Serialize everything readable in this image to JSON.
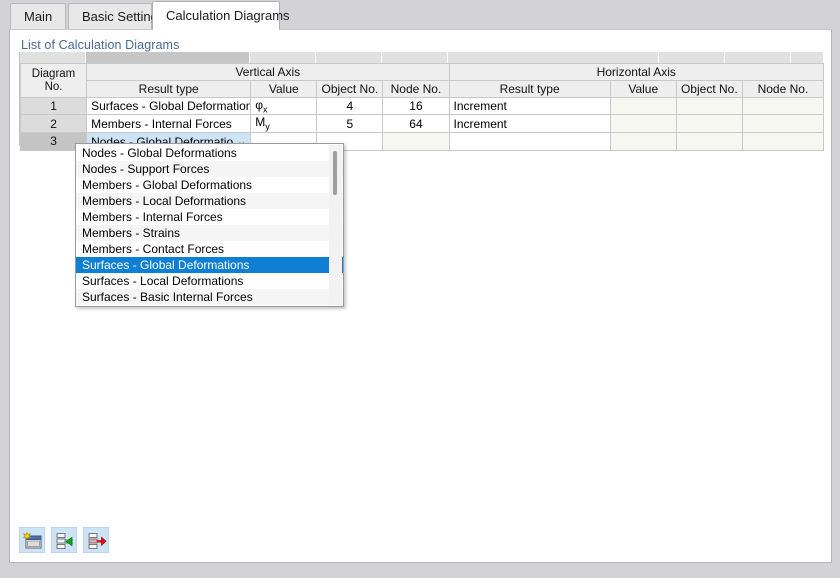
{
  "window": {
    "background_color": "#d2d2d7",
    "panel_background": "#ffffff"
  },
  "tabs": [
    {
      "label": "Main",
      "active": false
    },
    {
      "label": "Basic Settings",
      "active": false
    },
    {
      "label": "Calculation Diagrams",
      "active": true
    }
  ],
  "group": {
    "title": "List of Calculation Diagrams",
    "title_color": "#4a6a96"
  },
  "table": {
    "axis_groups": [
      {
        "label": "Vertical Axis"
      },
      {
        "label": "Horizontal Axis"
      }
    ],
    "row_header": {
      "line1": "Diagram",
      "line2": "No."
    },
    "columns": [
      "Result type",
      "Value",
      "Object No.",
      "Node No.",
      "Result type",
      "Value",
      "Object No.",
      "Node No."
    ],
    "rows": [
      {
        "no": "1",
        "selected": false,
        "editing": false,
        "v_result_type": "Surfaces - Global Deformations",
        "v_value_base": "φ",
        "v_value_sub": "x",
        "v_object_no": "4",
        "v_node_no": "16",
        "h_result_type": "Increment",
        "h_value": "",
        "h_object_no": "",
        "h_node_no": ""
      },
      {
        "no": "2",
        "selected": false,
        "editing": false,
        "v_result_type": "Members - Internal Forces",
        "v_value_base": "M",
        "v_value_sub": "y",
        "v_object_no": "5",
        "v_node_no": "64",
        "h_result_type": "Increment",
        "h_value": "",
        "h_object_no": "",
        "h_node_no": ""
      },
      {
        "no": "3",
        "selected": true,
        "editing": true,
        "v_result_type": "Nodes - Global Deformatio...",
        "v_value_base": "",
        "v_value_sub": "",
        "v_object_no": "",
        "v_node_no": "",
        "h_result_type": "",
        "h_value": "",
        "h_object_no": "",
        "h_node_no": ""
      }
    ]
  },
  "combobox": {
    "value": "Nodes - Global Deformatio...",
    "chevron": "⌄",
    "background": "#cfe3f7"
  },
  "dropdown": {
    "highlight_color": "#0f7fd4",
    "items": [
      {
        "label": "Nodes - Global Deformations",
        "highlighted": false
      },
      {
        "label": "Nodes - Support Forces",
        "highlighted": false
      },
      {
        "label": "Members - Global Deformations",
        "highlighted": false
      },
      {
        "label": "Members - Local Deformations",
        "highlighted": false
      },
      {
        "label": "Members - Internal Forces",
        "highlighted": false
      },
      {
        "label": "Members - Strains",
        "highlighted": false
      },
      {
        "label": "Members - Contact Forces",
        "highlighted": false
      },
      {
        "label": "Surfaces - Global Deformations",
        "highlighted": true
      },
      {
        "label": "Surfaces - Local Deformations",
        "highlighted": false
      },
      {
        "label": "Surfaces - Basic Internal Forces",
        "highlighted": false
      }
    ]
  },
  "toolbar": {
    "buttons": [
      {
        "name": "new-row-icon",
        "title": "New"
      },
      {
        "name": "insert-row-icon",
        "title": "Insert"
      },
      {
        "name": "delete-row-icon",
        "title": "Delete"
      }
    ]
  }
}
